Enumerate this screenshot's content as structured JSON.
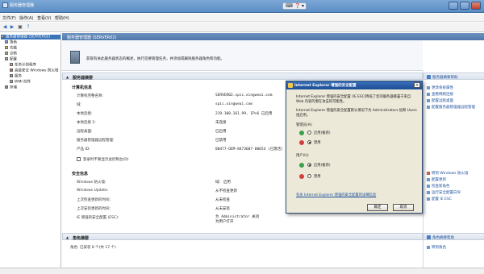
{
  "window": {
    "title": "服务器管理器"
  },
  "menu": {
    "items": [
      "文件(F)",
      "操作(A)",
      "查看(V)",
      "帮助(H)"
    ]
  },
  "tree": {
    "root": "服务器管理器 (SERVER02)",
    "items": [
      "角色",
      "功能",
      "诊断",
      "配置",
      "任务计划程序",
      "高级安全 Windows 防火墙",
      "服务",
      "WMI 控件",
      "存储"
    ]
  },
  "main": {
    "header": "服务器管理器 (SERVER02)",
    "info": "获取有关此服务器状态的概述，执行首要管理任务，并添加或删除服务器角色和功能。"
  },
  "summary": {
    "title": "服务器摘要",
    "computer_info_title": "计算机信息",
    "fields": [
      {
        "label": "计算机完整名称:",
        "value": "SERVER02.spic.xingweai.com"
      },
      {
        "label": "域:",
        "value": "spic.xingweai.com"
      },
      {
        "label": "本地连接:",
        "value": "219.100.161.99, IPv6 已启用"
      },
      {
        "label": "本地连接 2:",
        "value": "未连接"
      },
      {
        "label": "远程桌面:",
        "value": "已启用"
      },
      {
        "label": "服务器管理器远程管理:",
        "value": "已禁用"
      },
      {
        "label": "产品 ID:",
        "value": "00477-OEM-8473607-00654 (已激活)"
      }
    ],
    "checkbox_label": "登录时不要显示此控制台(D)",
    "security_title": "安全信息",
    "security_fields": [
      {
        "label": "Windows 防火墙:",
        "value": "域: 启用"
      },
      {
        "label": "Windows Update:",
        "value": "从不检查更新"
      },
      {
        "label": "上次检查更新的时间:",
        "value": "从未检查"
      },
      {
        "label": "上次安装更新的时间:",
        "value": "从未安装"
      },
      {
        "label": "IE 增强的安全配置 (ESC):",
        "value": "为 Administrator 关闭\n为用户打开"
      }
    ],
    "roles_title": "角色摘要",
    "roles_sub": "角色: 已安装 8 个(共 17 个)"
  },
  "right": {
    "summary_help": "服务器摘要帮助",
    "links1": [
      "更改系统属性",
      "查看网络连接",
      "配置远程桌面",
      "配置服务器管理器远程管理"
    ],
    "links2": [
      "转到 Windows 防火墙",
      "配置更新",
      "检查新角色",
      "运行安全配置向导",
      "配置 IE ESC"
    ],
    "roles_help": "角色摘要帮助",
    "roles_link": "转到角色"
  },
  "dialog": {
    "title": "Internet Explorer 增强的安全配置",
    "desc1": "Internet Explorer 增强的安全配置 (IE ESC)降低了您的服务器暴露于来自 Web 内容的潜在攻击的可能性。",
    "desc2": "Internet Explorer 增强的安全配置默认情况下为 Administrators 组和 Users 组启用。",
    "admin_label": "管理员(A):",
    "users_label": "用户(U):",
    "on_label": "启用(推荐)",
    "off_label": "禁用",
    "link": "有关 Internet Explorer 增强的安全配置的详细信息",
    "ok": "确定",
    "cancel": "取消"
  }
}
